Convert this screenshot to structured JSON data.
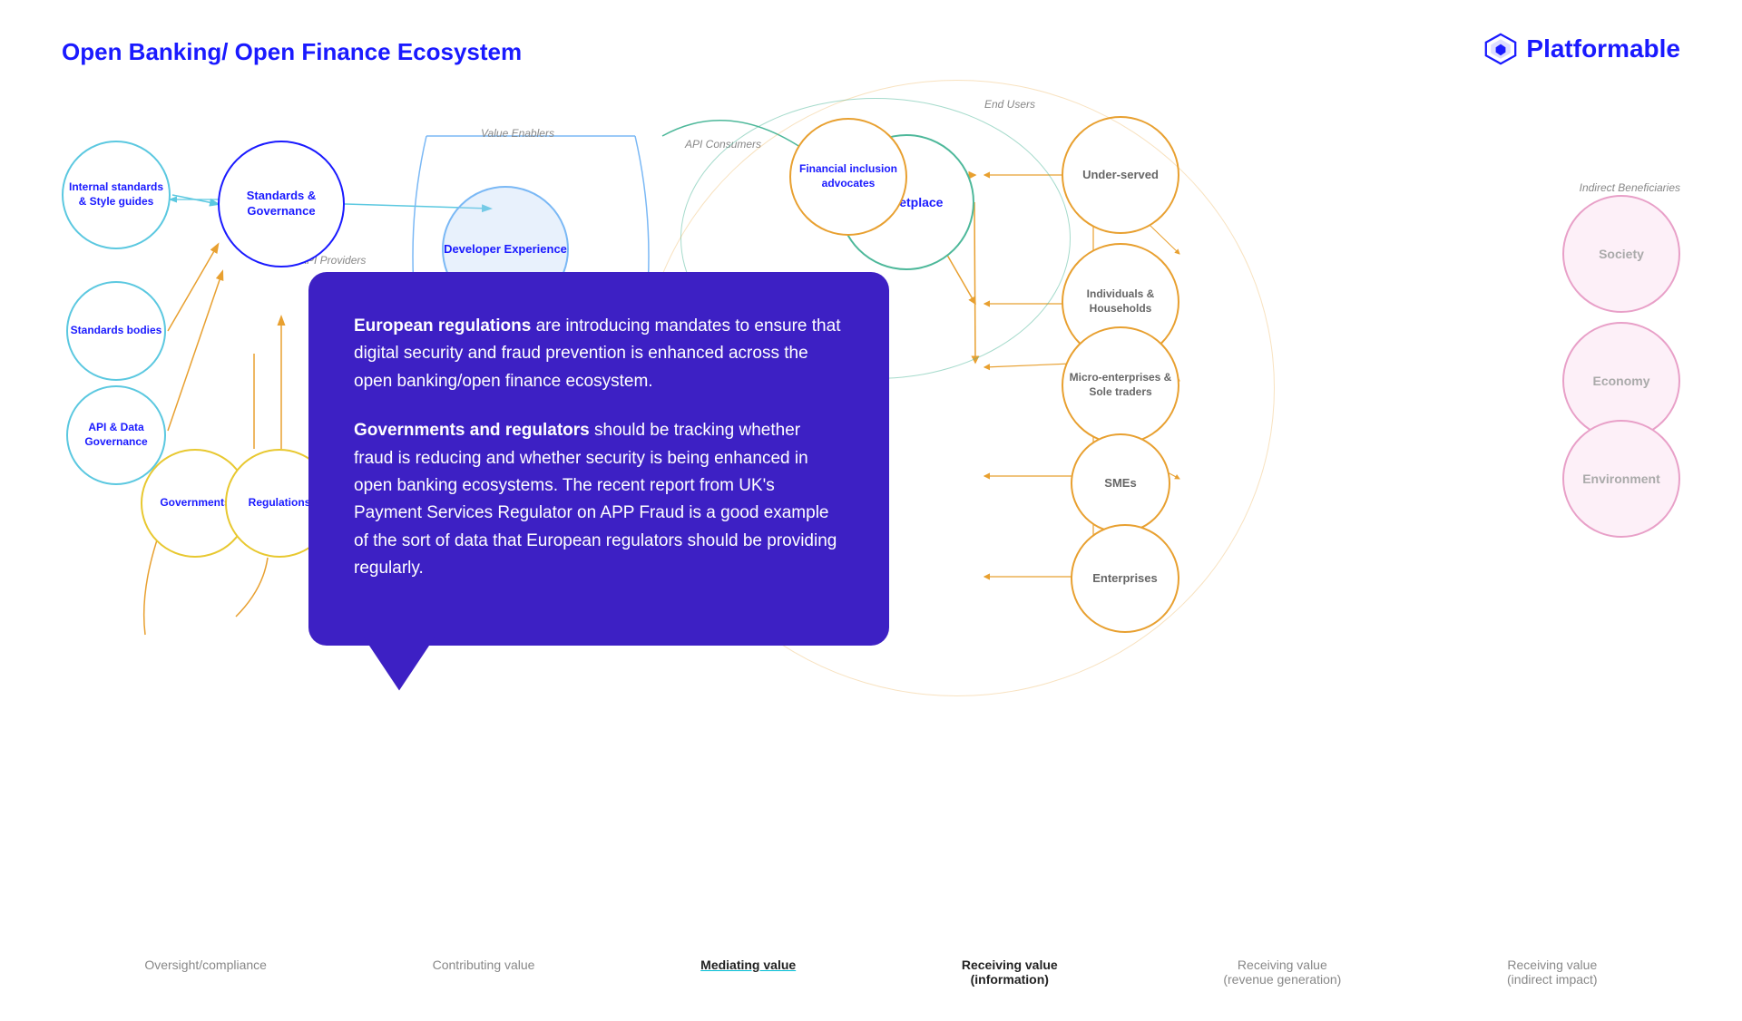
{
  "page": {
    "title": "Open Banking/ Open Finance Ecosystem"
  },
  "logo": {
    "text": "Platformable"
  },
  "circles": {
    "internal_standards": "Internal standards & Style guides",
    "standards_bodies": "Standards bodies",
    "api_data_governance": "API & Data Governance",
    "standards_governance": "Standards & Governance",
    "governments": "Governments",
    "regulations": "Regulations",
    "developer_experience": "Developer Experience",
    "marketplace": "Marketplace",
    "financial_inclusion": "Financial inclusion advocates",
    "under_served": "Under-served",
    "individuals_households": "Individuals & Households",
    "micro_enterprises": "Micro-enterprises & Sole traders",
    "smes": "SMEs",
    "enterprises": "Enterprises",
    "society": "Society",
    "economy": "Economy",
    "environment": "Environment"
  },
  "labels": {
    "end_users": "End Users",
    "api_consumers": "API Consumers",
    "value_enablers": "Value Enablers",
    "api_providers": "API Providers",
    "indirect_beneficiaries": "Indirect Beneficiaries"
  },
  "popup": {
    "para1_bold": "European regulations",
    "para1_rest": " are introducing mandates to ensure that digital security and fraud prevention is enhanced across the open banking/open finance ecosystem.",
    "para2_bold": "Governments and regulators",
    "para2_rest": " should be tracking whether fraud is reducing and whether security is being enhanced in open banking ecosystems. The recent report from UK's Payment Services Regulator on APP Fraud is a good example of the sort of data that European regulators should be providing regularly."
  },
  "bottom_labels": [
    {
      "text": "Oversight/compliance",
      "bold": false
    },
    {
      "text": "Contributing value",
      "bold": false
    },
    {
      "text": "Mediating value",
      "bold": true,
      "underline": true
    },
    {
      "text": "Receiving value\n(information)",
      "bold": true
    },
    {
      "text": "Receiving value\n(revenue generation)",
      "bold": false
    },
    {
      "text": "Receiving value\n(indirect impact)",
      "bold": false
    }
  ],
  "colors": {
    "blue": "#1a1aff",
    "teal": "#5bc8e0",
    "orange": "#e8a030",
    "green": "#4db89a",
    "pink": "#e8a0c8",
    "purple": "#3d20c4",
    "yellow": "#e8c830",
    "light_blue": "#7ab8f5"
  }
}
